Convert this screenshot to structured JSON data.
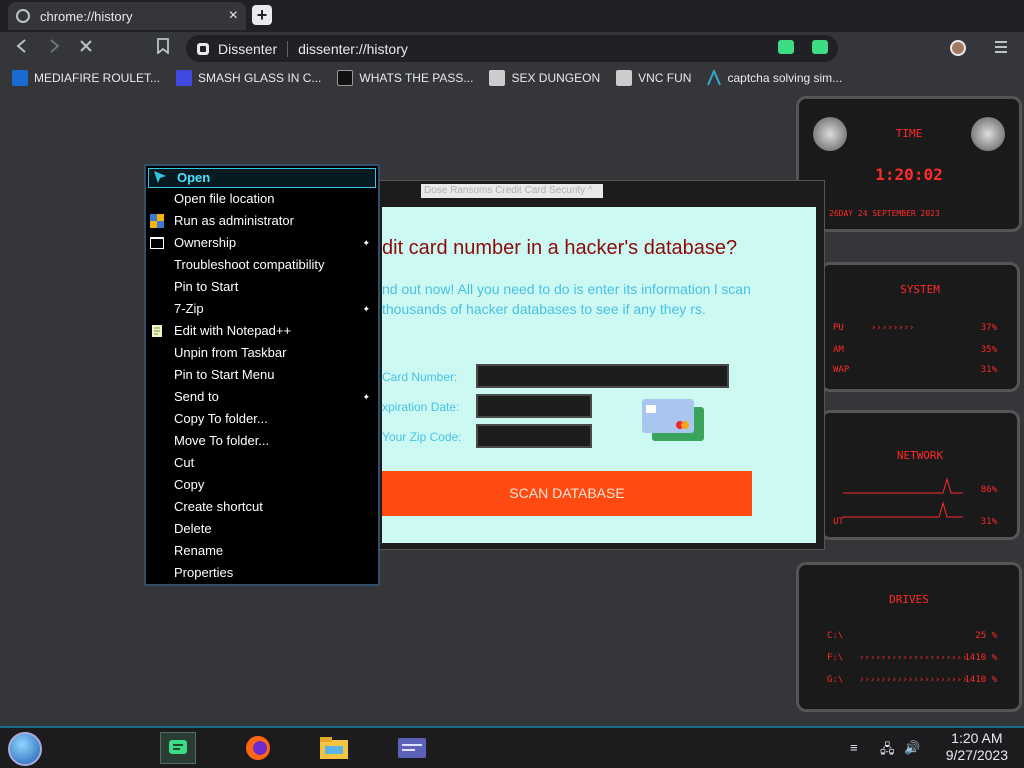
{
  "browser": {
    "tab_title": "chrome://history",
    "tab_close": "×",
    "new_tab": "+",
    "site_name": "Dissenter",
    "url": "dissenter://history"
  },
  "bookmarks": [
    {
      "label": "MEDIAFIRE ROULET...",
      "icon_color": "#1b6ad1"
    },
    {
      "label": "SMASH GLASS IN C...",
      "icon_color": "#3f4be0"
    },
    {
      "label": "WHATS THE PASS...",
      "icon_color": "#111111"
    },
    {
      "label": "SEX DUNGEON",
      "icon_color": "#cccccc"
    },
    {
      "label": "VNC FUN",
      "icon_color": "#cccccc"
    },
    {
      "label": "captcha solving sim...",
      "icon_color": "#35a7c9"
    }
  ],
  "dialog": {
    "title": "Dose Ransoms Credit Card Security ^",
    "heading": "dit card number in a hacker's database?",
    "description": "nd out now! All you need to do is enter its information l scan thousands of hacker databases to see if any they rs.",
    "card_label": "Card Number:",
    "expiration_label": "xpiration Date:",
    "zip_label": "Your Zip Code:",
    "scan_button": "SCAN DATABASE"
  },
  "context_menu": {
    "items": [
      {
        "label": "Open",
        "icon": "cursor-icon",
        "submenu": false
      },
      {
        "label": "Open file location",
        "icon": "",
        "submenu": false
      },
      {
        "label": "Run as administrator",
        "icon": "shield-icon",
        "submenu": false
      },
      {
        "label": "Ownership",
        "icon": "cmd-icon",
        "submenu": true
      },
      {
        "label": "Troubleshoot compatibility",
        "icon": "",
        "submenu": false
      },
      {
        "label": "Pin to Start",
        "icon": "",
        "submenu": false
      },
      {
        "label": "7-Zip",
        "icon": "",
        "submenu": true
      },
      {
        "label": "Edit with Notepad++",
        "icon": "notepad-icon",
        "submenu": false
      },
      {
        "label": "Unpin from Taskbar",
        "icon": "",
        "submenu": false
      },
      {
        "label": "Pin to Start Menu",
        "icon": "",
        "submenu": false
      },
      {
        "label": "Send to",
        "icon": "",
        "submenu": true
      },
      {
        "label": "Copy To folder...",
        "icon": "",
        "submenu": false
      },
      {
        "label": "Move To folder...",
        "icon": "",
        "submenu": false
      },
      {
        "label": "Cut",
        "icon": "",
        "submenu": false
      },
      {
        "label": "Copy",
        "icon": "",
        "submenu": false
      },
      {
        "label": "Create shortcut",
        "icon": "",
        "submenu": false
      },
      {
        "label": "Delete",
        "icon": "",
        "submenu": false
      },
      {
        "label": "Rename",
        "icon": "",
        "submenu": false
      },
      {
        "label": "Properties",
        "icon": "",
        "submenu": false
      }
    ]
  },
  "widgets": {
    "time": {
      "head": "TIME",
      "clock": "1:20:02",
      "date": "26DAY 24 SEPTEMBER 2023"
    },
    "system": {
      "head": "SYSTEM",
      "cpu_label": "PU",
      "cpu_value": "37%",
      "ram_label": "AM",
      "ram_value": "35%",
      "swap_label": "WAP",
      "swap_value": "31%"
    },
    "network": {
      "head": "NETWORK",
      "in_value": "86%",
      "out_label": "UT",
      "out_value": "31%"
    },
    "drives": {
      "head": "DRIVES",
      "c_label": "C:\\",
      "c_value": "25 %",
      "f_label": "F:\\",
      "f_value": "1410 %",
      "g_label": "G:\\",
      "g_value": "1410 %"
    }
  },
  "taskbar": {
    "time": "1:20 AM",
    "date": "9/27/2023"
  }
}
